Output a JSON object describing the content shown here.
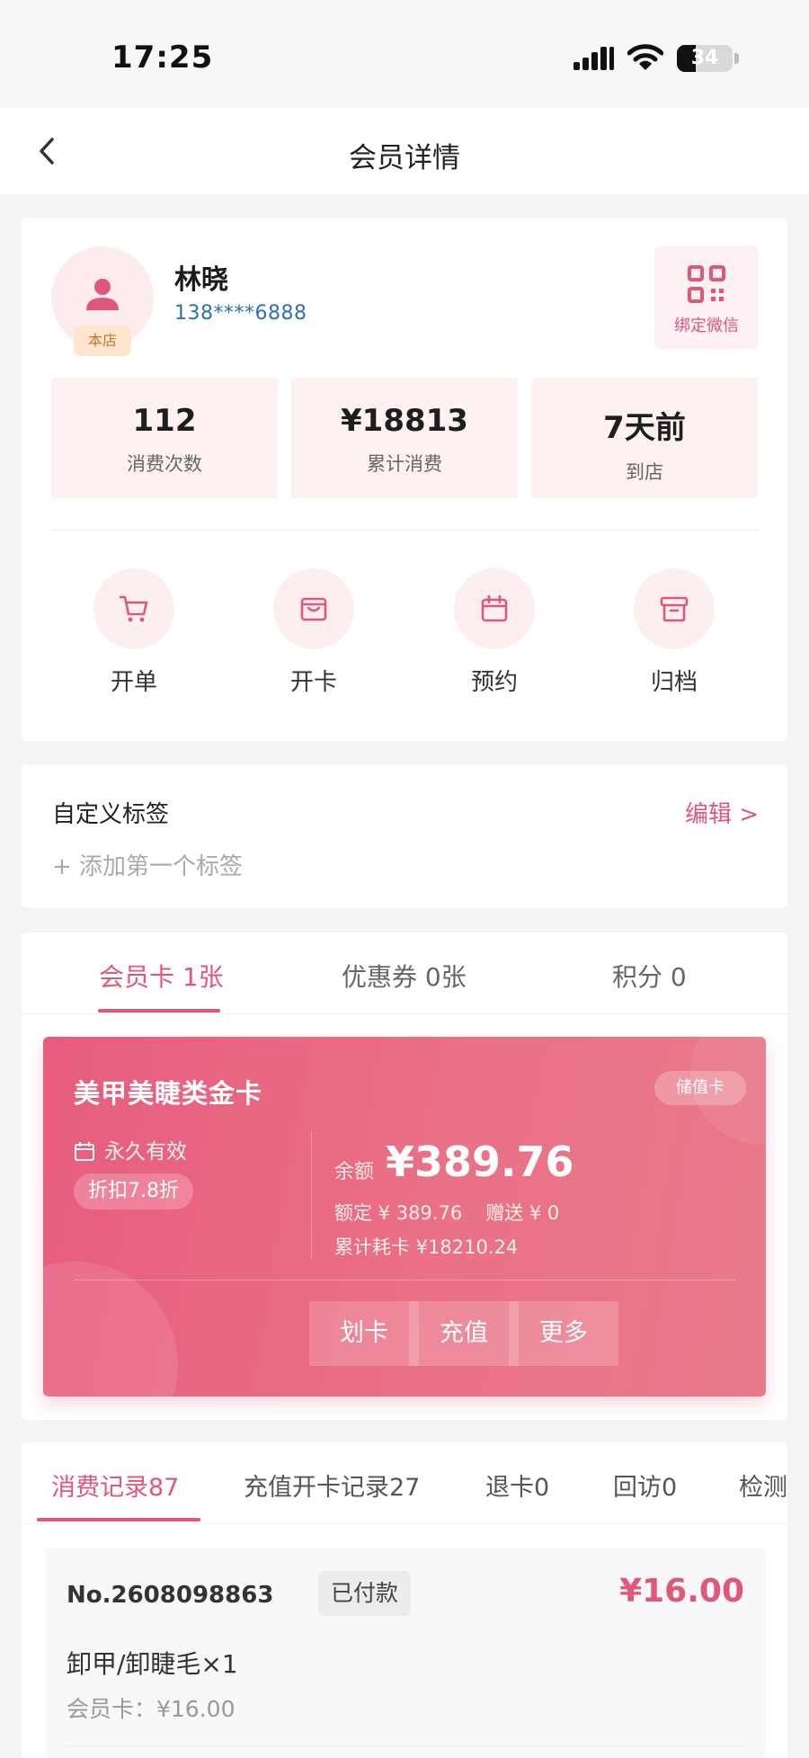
{
  "status_bar": {
    "time": "17:25",
    "battery": "34",
    "battery_level": 0.34,
    "icons": [
      "signal-icon",
      "wifi-icon",
      "battery-icon"
    ]
  },
  "nav": {
    "title": "会员详情",
    "back_icon": "chevron-left-icon"
  },
  "profile": {
    "name": "林晓",
    "phone": "138****6888",
    "store_badge": "本店",
    "wechat_label": "绑定微信",
    "avatar_icon": "person-icon",
    "wechat_icon": "qr-code-icon"
  },
  "stats": [
    {
      "value": "112",
      "label": "消费次数"
    },
    {
      "value": "¥18813",
      "label": "累计消费"
    },
    {
      "value": "7天前",
      "label": "到店"
    }
  ],
  "actions": [
    {
      "label": "开单",
      "icon": "cart-icon"
    },
    {
      "label": "开卡",
      "icon": "card-wallet-icon"
    },
    {
      "label": "预约",
      "icon": "calendar-icon"
    },
    {
      "label": "归档",
      "icon": "archive-box-icon"
    }
  ],
  "tags": {
    "title": "自定义标签",
    "edit": "编辑 >",
    "add": "+ 添加第一个标签"
  },
  "card_tabs": [
    "会员卡 1张",
    "优惠券 0张",
    "积分 0"
  ],
  "member_card": {
    "name": "美甲美睫类金卡",
    "type": "储值卡",
    "validity": "永久有效",
    "discount": "折扣7.8折",
    "balance_label": "余额",
    "balance": "¥389.76",
    "quota": "额定 ¥ 389.76",
    "gift": "赠送 ¥ 0",
    "consumed": "累计耗卡 ¥18210.24",
    "buttons": [
      "划卡",
      "充值",
      "更多"
    ]
  },
  "record_tabs": [
    "消费记录87",
    "充值开卡记录27",
    "退卡0",
    "回访0",
    "检测"
  ],
  "record": {
    "no": "No.2608098863",
    "status": "已付款",
    "amount": "¥16.00",
    "item": "卸甲/卸睫毛×1",
    "payment": "会员卡：¥16.00"
  },
  "colors": {
    "accent": "#e0577a",
    "card_gradient_start": "#e85c7f",
    "card_gradient_end": "#e9798a",
    "phone_link": "#2f6fb6",
    "badge_bg": "#fde6cd",
    "badge_text": "#c8762e"
  }
}
